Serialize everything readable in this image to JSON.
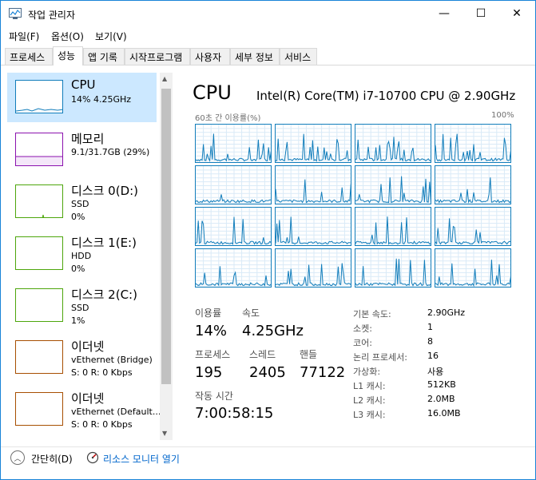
{
  "window": {
    "title": "작업 관리자",
    "min_glyph": "—",
    "max_glyph": "☐",
    "close_glyph": "✕"
  },
  "menu": [
    "파일(F)",
    "옵션(O)",
    "보기(V)"
  ],
  "tabs": [
    "프로세스",
    "성능",
    "앱 기록",
    "시작프로그램",
    "사용자",
    "세부 정보",
    "서비스"
  ],
  "active_tab": "성능",
  "sidebar": {
    "items": [
      {
        "name": "CPU",
        "sub1": "14%  4.25GHz",
        "sub2": "",
        "color": "#117dbb",
        "selected": true
      },
      {
        "name": "메모리",
        "sub1": "9.1/31.7GB (29%)",
        "sub2": "",
        "color": "#8b12ae",
        "selected": false
      },
      {
        "name": "디스크 0(D:)",
        "sub1": "SSD",
        "sub2": "0%",
        "color": "#4da60c",
        "selected": false
      },
      {
        "name": "디스크 1(E:)",
        "sub1": "HDD",
        "sub2": "0%",
        "color": "#4da60c",
        "selected": false
      },
      {
        "name": "디스크 2(C:)",
        "sub1": "SSD",
        "sub2": "1%",
        "color": "#4da60c",
        "selected": false
      },
      {
        "name": "이더넷",
        "sub1": "vEthernet (Bridge)",
        "sub2": "S: 0  R: 0 Kbps",
        "color": "#a74f01",
        "selected": false
      },
      {
        "name": "이더넷",
        "sub1": "vEthernet (Default...",
        "sub2": "S: 0  R: 0 Kbps",
        "color": "#a74f01",
        "selected": false
      }
    ]
  },
  "panel": {
    "title": "CPU",
    "model": "Intel(R) Core(TM) i7-10700 CPU @ 2.90GHz",
    "graph_caption": "60초 간 이용률(%)",
    "graph_max": "100%",
    "graph_color": "#117dbb",
    "stats": {
      "utilization_label": "이용률",
      "utilization": "14%",
      "speed_label": "속도",
      "speed": "4.25GHz",
      "processes_label": "프로세스",
      "processes": "195",
      "threads_label": "스레드",
      "threads": "2405",
      "handles_label": "핸들",
      "handles": "77122",
      "uptime_label": "작동 시간",
      "uptime": "7:00:58:15"
    },
    "info": [
      {
        "label": "기본 속도:",
        "value": "2.90GHz"
      },
      {
        "label": "소켓:",
        "value": "1"
      },
      {
        "label": "코어:",
        "value": "8"
      },
      {
        "label": "논리 프로세서:",
        "value": "16"
      },
      {
        "label": "가상화:",
        "value": "사용"
      },
      {
        "label": "L1 캐시:",
        "value": "512KB"
      },
      {
        "label": "L2 캐시:",
        "value": "2.0MB"
      },
      {
        "label": "L3 캐시:",
        "value": "16.0MB"
      }
    ]
  },
  "footer": {
    "fewer_details": "간단히(D)",
    "resource_monitor": "리소스 모니터 열기"
  }
}
